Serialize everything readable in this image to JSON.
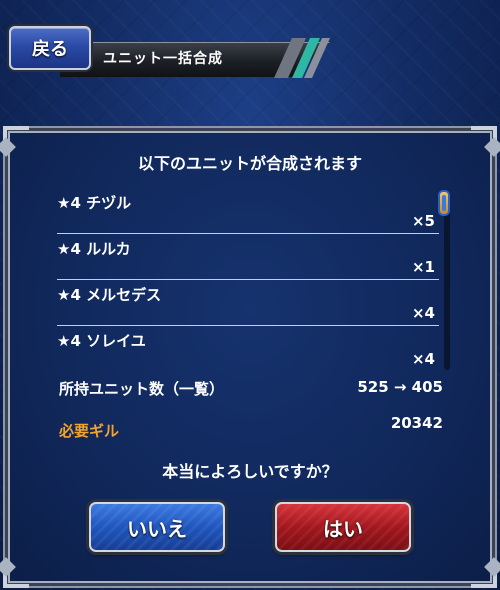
{
  "header": {
    "back_label": "戻る",
    "title": "ユニット一括合成"
  },
  "dialog": {
    "title": "以下のユニットが合成されます",
    "units": [
      {
        "name": "★4 チヅル",
        "qty": "×5"
      },
      {
        "name": "★4 ルルカ",
        "qty": "×1"
      },
      {
        "name": "★4 メルセデス",
        "qty": "×4"
      },
      {
        "name": "★4 ソレイユ",
        "qty": "×4"
      }
    ],
    "owned_label": "所持ユニット数（一覧）",
    "owned_value": "525 → 405",
    "gil_label": "必要ギル",
    "gil_value": "20342",
    "confirm_text": "本当によろしいですか？",
    "no_label": "いいえ",
    "yes_label": "はい"
  },
  "colors": {
    "gil_label": "#f3a42a",
    "no_button": "#1f56bf",
    "yes_button": "#a3171e",
    "background": "#132c64"
  }
}
